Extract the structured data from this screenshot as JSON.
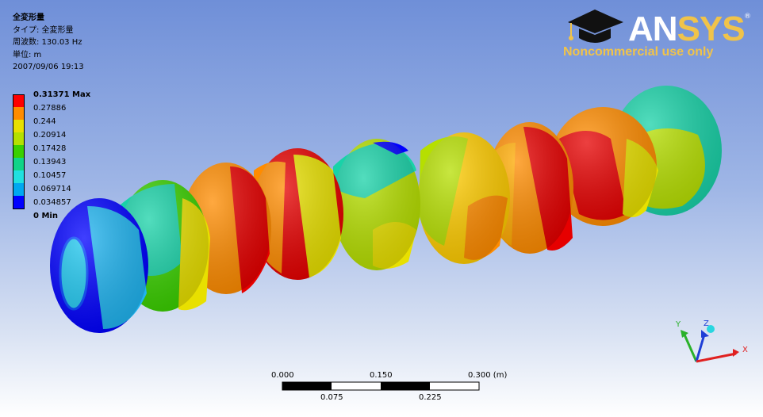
{
  "result": {
    "title": "全変形量",
    "type_line": "タイプ: 全変形量",
    "frequency_line": "周波数: 130.03 Hz",
    "unit_line": "単位: m",
    "date_line": "2007/09/06 19:13"
  },
  "legend": {
    "labels": [
      "0.31371 Max",
      "0.27886",
      "0.244",
      "0.20914",
      "0.17428",
      "0.13943",
      "0.10457",
      "0.069714",
      "0.034857",
      "0 Min"
    ],
    "colors": [
      "#ff0000",
      "#ff8c00",
      "#e8e000",
      "#b5e000",
      "#3ad000",
      "#10d488",
      "#20e0e0",
      "#00a8f0",
      "#0000ff"
    ]
  },
  "logo": {
    "word_a": "AN",
    "word_b": "SYS",
    "registered": "®",
    "tagline": "Noncommercial use only"
  },
  "scale": {
    "ticks_top": [
      "0.000",
      "0.150",
      "0.300 (m)"
    ],
    "ticks_bottom": [
      "0.075",
      "0.225"
    ]
  },
  "triad": {
    "x": "X",
    "y": "Y",
    "z": "Z"
  }
}
